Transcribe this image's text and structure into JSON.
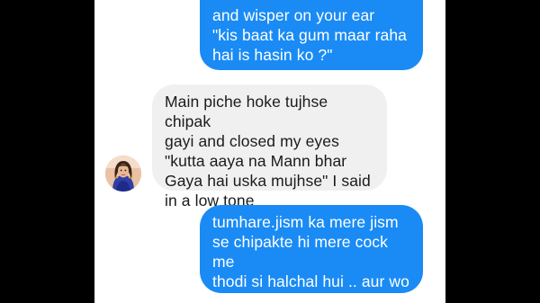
{
  "conversation": {
    "messages": [
      {
        "direction": "sent",
        "text": "and wisper on your ear\n\"kis baat ka gum maar raha\nhai is hasin ko ?\""
      },
      {
        "direction": "received",
        "text": "Main piche hoke tujhse chipak\ngayi and closed my eyes\n\"kutta aaya na Mann bhar\nGaya hai uska mujhse\" I said\nin a low tone"
      },
      {
        "direction": "sent",
        "text": "tumhare.jism ka mere jism\nse chipakte hi mere cock me\nthodi si halchal hui .. aur wo\nthoda tight hone laga"
      }
    ],
    "avatar_icon": "user-avatar-photo"
  },
  "colors": {
    "sent_bubble": "#1a8bf5",
    "received_bubble": "#f0f0f0",
    "background": "#ffffff",
    "letterbox": "#000000"
  }
}
